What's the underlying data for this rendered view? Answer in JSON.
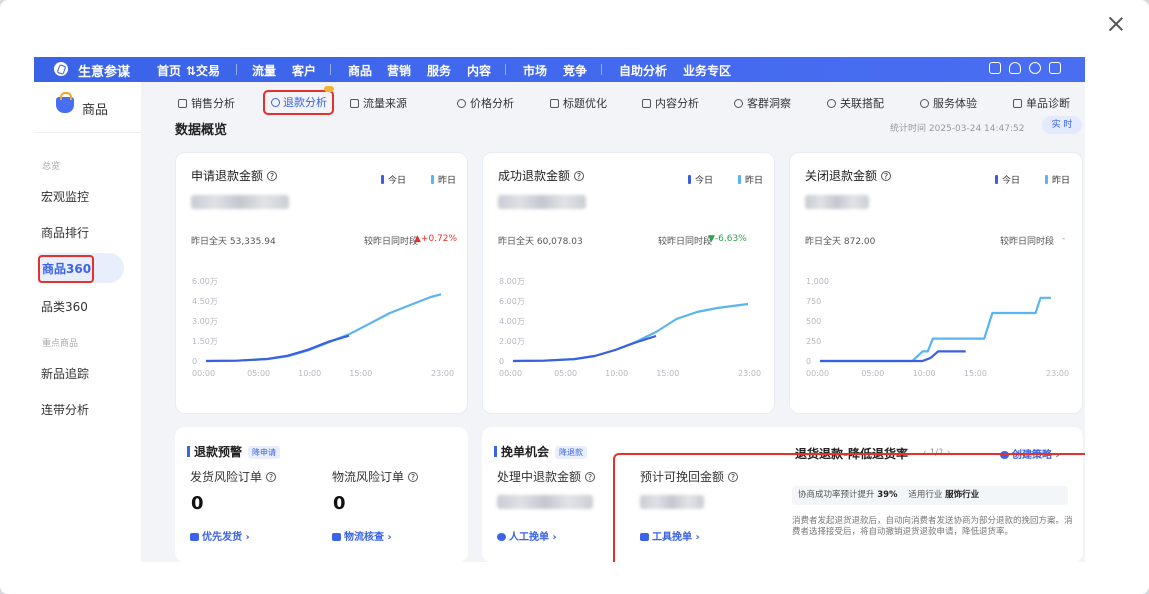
{
  "close_label": "×",
  "topnav": {
    "brand": "生意参谋",
    "items": [
      "首页",
      "⇅交易",
      "流量",
      "客户",
      "商品",
      "营销",
      "服务",
      "内容",
      "市场",
      "竞争",
      "自助分析",
      "业务专区"
    ]
  },
  "sidebar": {
    "header": "商品",
    "group1": "总览",
    "items1": [
      "宏观监控",
      "商品排行",
      "商品360",
      "品类360"
    ],
    "group2": "重点商品",
    "items2": [
      "新品追踪",
      "连带分析"
    ]
  },
  "tabs": [
    "销售分析",
    "退款分析",
    "流量来源",
    "价格分析",
    "标题优化",
    "内容分析",
    "客群洞察",
    "关联搭配",
    "服务体验",
    "单品诊断"
  ],
  "overview": {
    "title": "数据概览",
    "stat_time": "统计时间 2025-03-24 14:47:52",
    "realtime": "实 时"
  },
  "legend": {
    "today": "今日",
    "yesterday": "昨日"
  },
  "cards": [
    {
      "title": "申请退款金额",
      "yesterday_total": "昨日全天  53,335.94",
      "compare_label": "较昨日同时段",
      "compare_value": "▲+0.72%"
    },
    {
      "title": "成功退款金额",
      "yesterday_total": "昨日全天  60,078.03",
      "compare_label": "较昨日同时段",
      "compare_value": "▼-6.63%"
    },
    {
      "title": "关闭退款金额",
      "yesterday_total": "昨日全天  872.00",
      "compare_label": "较昨日同时段",
      "compare_value": "-"
    }
  ],
  "chart_data": [
    {
      "type": "line",
      "title": "申请退款金额",
      "x_ticks": [
        "00:00",
        "05:00",
        "10:00",
        "15:00",
        "23:00"
      ],
      "y_ticks": [
        "0",
        "1.50万",
        "3.00万",
        "4.50万",
        "6.00万"
      ],
      "ylim": [
        0,
        60000
      ],
      "series": [
        {
          "name": "昨日",
          "color": "#5ab4f0",
          "x": [
            0,
            3,
            6,
            8,
            10,
            12,
            14,
            16,
            18,
            20,
            22,
            23
          ],
          "y": [
            0,
            200,
            1500,
            3500,
            8000,
            14000,
            20000,
            28000,
            36000,
            42000,
            48000,
            50000
          ]
        },
        {
          "name": "今日",
          "color": "#3a5fe0",
          "x": [
            0,
            3,
            6,
            8,
            10,
            12,
            14
          ],
          "y": [
            0,
            200,
            1500,
            4000,
            8500,
            14500,
            19000
          ]
        }
      ]
    },
    {
      "type": "line",
      "title": "成功退款金额",
      "x_ticks": [
        "00:00",
        "05:00",
        "10:00",
        "15:00",
        "23:00"
      ],
      "y_ticks": [
        "0",
        "2.00万",
        "4.00万",
        "6.00万",
        "8.00万"
      ],
      "ylim": [
        0,
        80000
      ],
      "series": [
        {
          "name": "昨日",
          "color": "#5ab4f0",
          "x": [
            0,
            3,
            6,
            8,
            10,
            12,
            14,
            16,
            18,
            20,
            23
          ],
          "y": [
            0,
            300,
            2000,
            5000,
            11000,
            19000,
            29000,
            42000,
            49000,
            53000,
            57000
          ]
        },
        {
          "name": "今日",
          "color": "#3a5fe0",
          "x": [
            0,
            3,
            6,
            8,
            10,
            12,
            14
          ],
          "y": [
            0,
            300,
            1800,
            5000,
            11000,
            18500,
            25000
          ]
        }
      ]
    },
    {
      "type": "line",
      "title": "关闭退款金额",
      "x_ticks": [
        "00:00",
        "05:00",
        "10:00",
        "15:00",
        "23:00"
      ],
      "y_ticks": [
        "0",
        "250",
        "500",
        "750",
        "1,000"
      ],
      "ylim": [
        0,
        1000
      ],
      "series": [
        {
          "name": "昨日",
          "color": "#5ab4f0",
          "x": [
            0,
            9,
            10,
            10.5,
            11,
            16,
            16.8,
            21,
            21.5,
            22.5
          ],
          "y": [
            0,
            0,
            120,
            120,
            280,
            280,
            600,
            600,
            790,
            790
          ]
        },
        {
          "name": "今日",
          "color": "#3a5fe0",
          "x": [
            0,
            9,
            10,
            10.8,
            11.5,
            14.2
          ],
          "y": [
            0,
            0,
            0,
            40,
            120,
            120
          ]
        }
      ]
    }
  ],
  "warn": {
    "title": "退款预警",
    "badge": "降申请",
    "col1_label": "发货风险订单",
    "col1_value": "0",
    "col1_link": "优先发货",
    "col2_label": "物流风险订单",
    "col2_value": "0",
    "col2_link": "物流核查"
  },
  "save": {
    "title": "挽单机会",
    "badge": "降退款",
    "col1_label": "处理中退款金额",
    "col1_link": "人工挽单",
    "col2_label": "预计可挽回金额",
    "col2_link": "工具挽单",
    "strategy_title": "退货退款-降低退货率",
    "pager": "‹ 1/1 ›",
    "create_link": "创建策略",
    "boost_text": "协商成功率预计提升",
    "boost_value": "39%",
    "industry_text": "适用行业",
    "industry_value": "服饰行业",
    "description": "消费者发起退货退款后，自动向消费者发送协商为部分退款的挽回方案。消费者选择接受后，将自动撤销退货退款申请，降低退货率。"
  },
  "colors": {
    "accent": "#3a63e8",
    "highlight": "#e5302c"
  }
}
